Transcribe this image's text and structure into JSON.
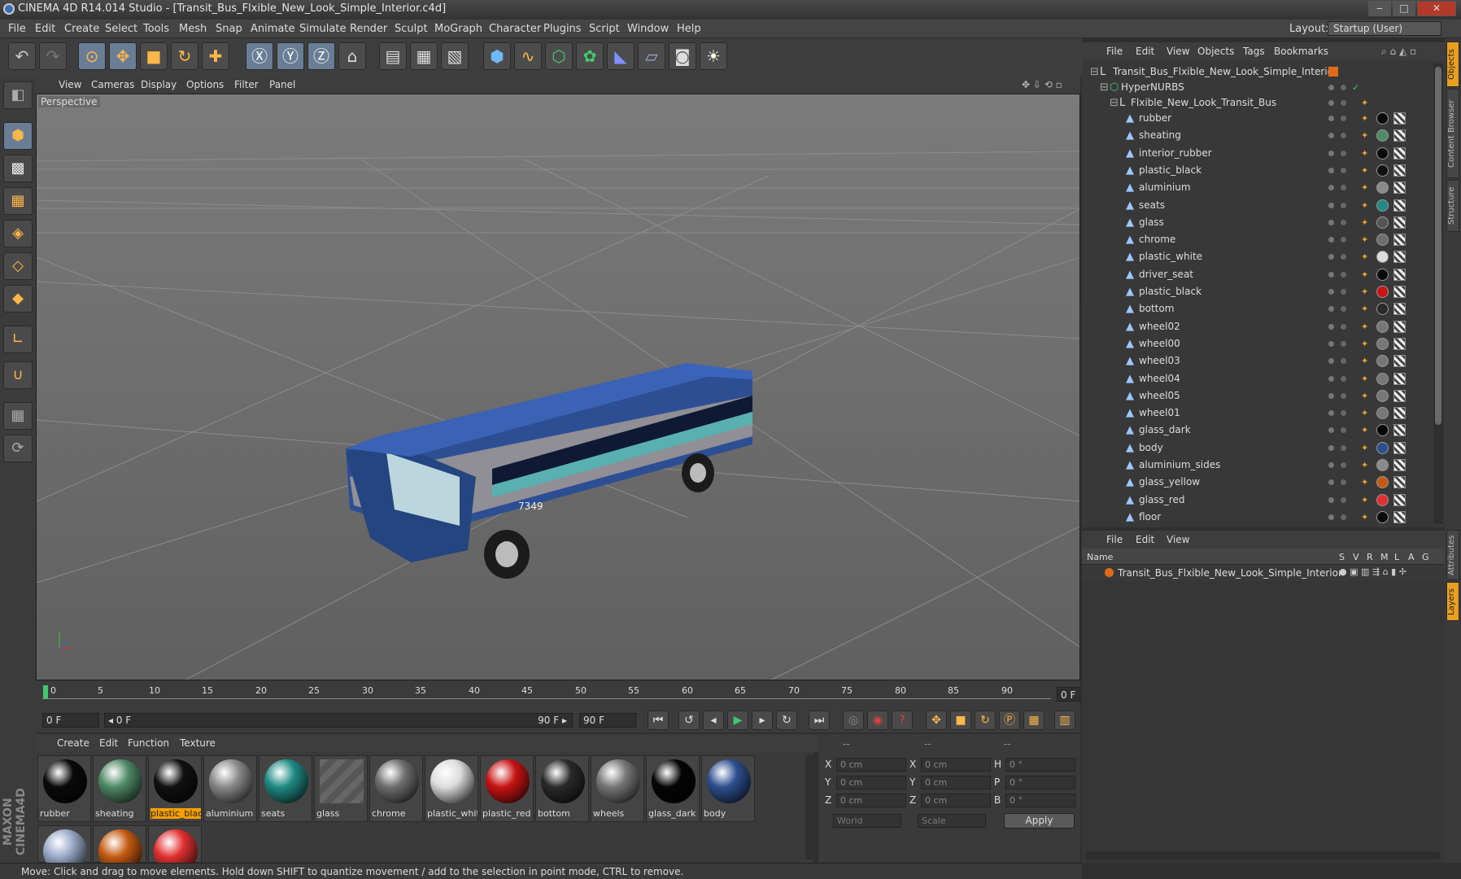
{
  "window": {
    "title": "CINEMA 4D R14.014 Studio - [Transit_Bus_Flxible_New_Look_Simple_Interior.c4d]",
    "min": "‒",
    "max": "□",
    "close": "✕"
  },
  "menubar": {
    "items": [
      "File",
      "Edit",
      "Create",
      "Select",
      "Tools",
      "Mesh",
      "Snap",
      "Animate",
      "Simulate",
      "Render",
      "Sculpt",
      "MoGraph",
      "Character",
      "Plugins",
      "Script",
      "Window",
      "Help"
    ],
    "layout_label": "Layout:",
    "layout_value": "Startup (User)"
  },
  "viewport": {
    "menu": [
      "View",
      "Cameras",
      "Display",
      "Options",
      "Filter",
      "Panel"
    ],
    "label": "Perspective",
    "bus_number": "7349"
  },
  "timeline": {
    "ticks": [
      "0",
      "5",
      "10",
      "15",
      "20",
      "25",
      "30",
      "35",
      "40",
      "45",
      "50",
      "55",
      "60",
      "65",
      "70",
      "75",
      "80",
      "85",
      "90"
    ],
    "current_frame": "0 F"
  },
  "transport": {
    "start": "0 F",
    "range_start": "◂ 0 F",
    "range_end": "90 F ▸",
    "end": "90 F"
  },
  "material_manager": {
    "menu": [
      "Create",
      "Edit",
      "Function",
      "Texture"
    ],
    "materials": [
      {
        "name": "rubber",
        "color": "#0a0a0a"
      },
      {
        "name": "sheating",
        "color": "#4f8a66"
      },
      {
        "name": "plastic_black",
        "color": "#111111",
        "selected": true
      },
      {
        "name": "aluminium",
        "color": "#8a8a8a"
      },
      {
        "name": "seats",
        "color": "#1f8a84"
      },
      {
        "name": "glass",
        "color": "#555555"
      },
      {
        "name": "chrome",
        "color": "#6e6e6e"
      },
      {
        "name": "plastic_white",
        "color": "#dddddd"
      },
      {
        "name": "plastic_red",
        "color": "#c81414"
      },
      {
        "name": "bottom",
        "color": "#2a2a2a"
      },
      {
        "name": "wheels",
        "color": "#777777"
      },
      {
        "name": "glass_dark",
        "color": "#050505"
      },
      {
        "name": "body",
        "color": "#2e4f8f"
      },
      {
        "name": "",
        "color": "#99aac8"
      },
      {
        "name": "",
        "color": "#c45a10"
      },
      {
        "name": "",
        "color": "#e03030"
      }
    ]
  },
  "coordinates": {
    "headers": [
      "--",
      "--",
      "--"
    ],
    "rows": [
      {
        "a": "X",
        "av": "0 cm",
        "b": "X",
        "bv": "0 cm",
        "c": "H",
        "cv": "0 °"
      },
      {
        "a": "Y",
        "av": "0 cm",
        "b": "Y",
        "bv": "0 cm",
        "c": "P",
        "cv": "0 °"
      },
      {
        "a": "Z",
        "av": "0 cm",
        "b": "Z",
        "bv": "0 cm",
        "c": "B",
        "cv": "0 °"
      }
    ],
    "mode1": "World",
    "mode2": "Scale",
    "apply": "Apply"
  },
  "status": "Move: Click and drag to move elements. Hold down SHIFT to quantize movement / add to the selection in point mode, CTRL to remove.",
  "object_manager": {
    "menu": [
      "File",
      "Edit",
      "View",
      "Objects",
      "Tags",
      "Bookmarks"
    ],
    "root": "Transit_Bus_Flxible_New_Look_Simple_Interior",
    "hypernurbs": "HyperNURBS",
    "group": "Flxible_New_Look_Transit_Bus",
    "objects": [
      {
        "name": "rubber",
        "mat": "#0a0a0a"
      },
      {
        "name": "sheating",
        "mat": "#4f8a66"
      },
      {
        "name": "interior_rubber",
        "mat": "#0a0a0a"
      },
      {
        "name": "plastic_black",
        "mat": "#111111"
      },
      {
        "name": "aluminium",
        "mat": "#8a8a8a"
      },
      {
        "name": "seats",
        "mat": "#1f8a84"
      },
      {
        "name": "glass",
        "mat": "#555555"
      },
      {
        "name": "chrome",
        "mat": "#6e6e6e"
      },
      {
        "name": "plastic_white",
        "mat": "#dddddd"
      },
      {
        "name": "driver_seat",
        "mat": "#0a0a0a"
      },
      {
        "name": "plastic_black",
        "mat": "#c81414"
      },
      {
        "name": "bottom",
        "mat": "#2a2a2a"
      },
      {
        "name": "wheel02",
        "mat": "#777777"
      },
      {
        "name": "wheel00",
        "mat": "#777777"
      },
      {
        "name": "wheel03",
        "mat": "#777777"
      },
      {
        "name": "wheel04",
        "mat": "#777777"
      },
      {
        "name": "wheel05",
        "mat": "#777777"
      },
      {
        "name": "wheel01",
        "mat": "#777777"
      },
      {
        "name": "glass_dark",
        "mat": "#050505"
      },
      {
        "name": "body",
        "mat": "#2e4f8f"
      },
      {
        "name": "aluminium_sides",
        "mat": "#8a8a8a"
      },
      {
        "name": "glass_yellow",
        "mat": "#c45a10"
      },
      {
        "name": "glass_red",
        "mat": "#e03030"
      },
      {
        "name": "floor",
        "mat": "#0a0a0a"
      }
    ]
  },
  "layer_manager": {
    "menu": [
      "File",
      "Edit",
      "View"
    ],
    "columns": [
      "Name",
      "S",
      "V",
      "R",
      "M",
      "L",
      "A",
      "G"
    ],
    "layer": "Transit_Bus_Flxible_New_Look_Simple_Interior",
    "layer_color": "#e06a1a"
  },
  "side_tabs": [
    "Objects",
    "Content Browser",
    "Structure",
    "Attributes",
    "Layers"
  ],
  "branding": "MAXON CINEMA4D"
}
